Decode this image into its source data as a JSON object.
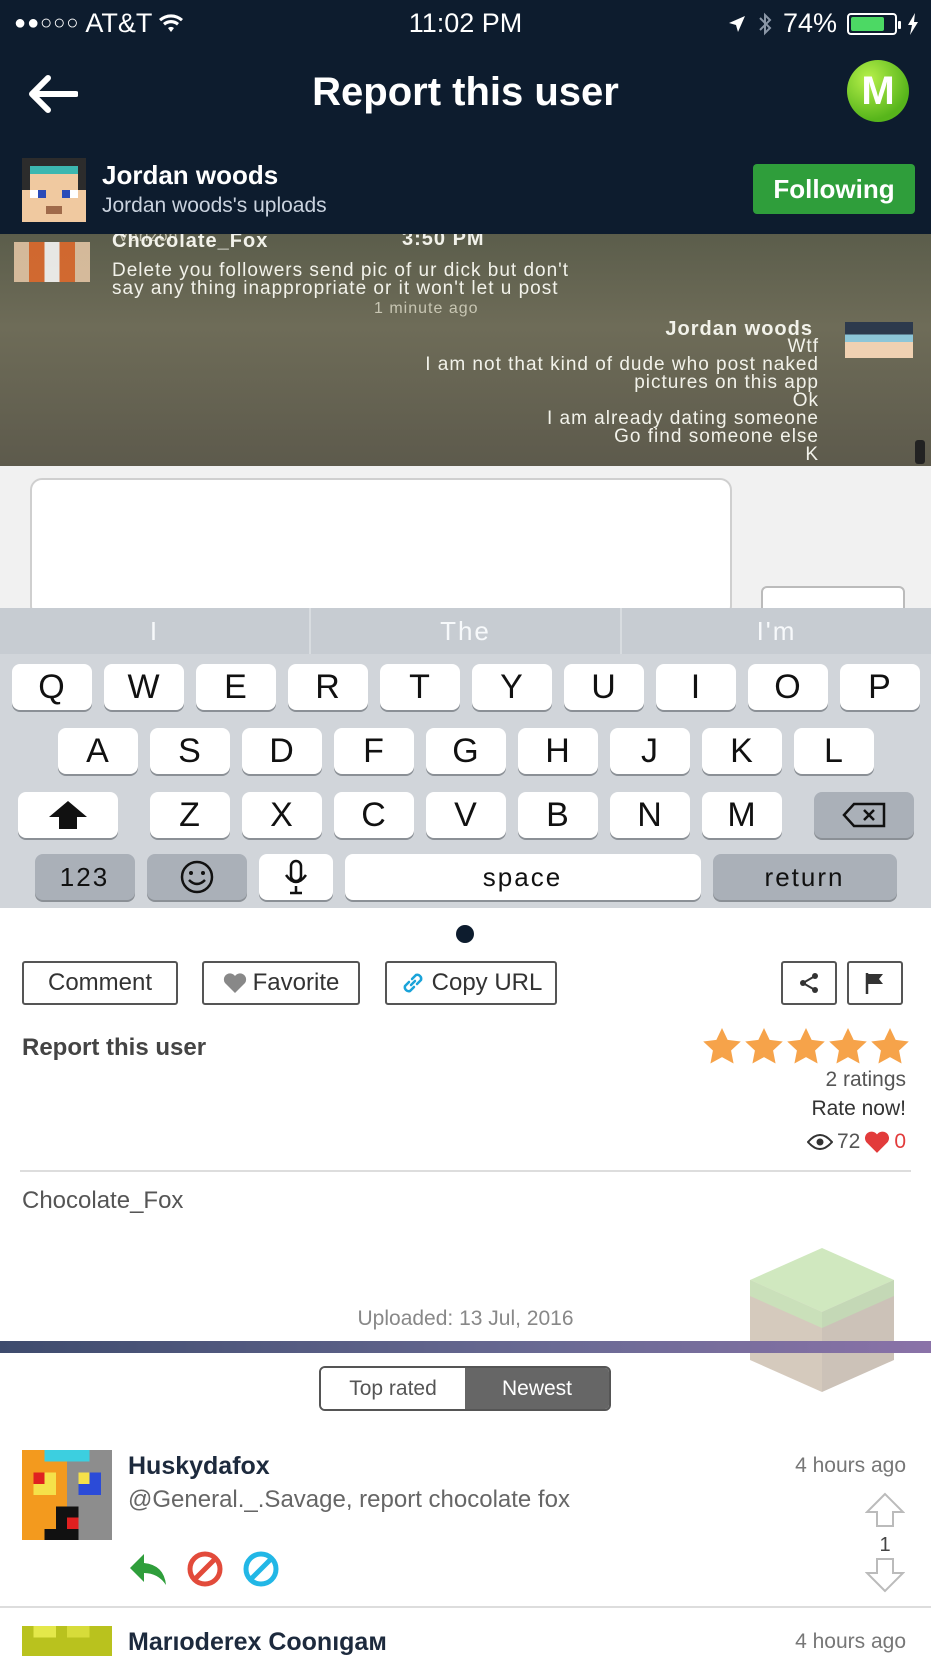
{
  "status_bar": {
    "carrier": "AT&T",
    "time": "11:02 PM",
    "battery": "74%"
  },
  "header": {
    "title": "Report this user",
    "logo_letter": "M"
  },
  "uploader": {
    "name": "Jordan woods",
    "subtitle": "Jordan woods's uploads",
    "follow_label": "Following"
  },
  "screenshot": {
    "top_carrier": "Verizon",
    "top_time": "3:50 PM",
    "sender1": "Chocolate_Fox",
    "msg1a": "Delete you followers send pic of ur dick but don't",
    "msg1b": "say any thing inappropriate or it won't let u post",
    "time1": "1 minute ago",
    "sender2": "Jordan woods",
    "lines2": [
      "Wtf",
      "I am not that kind of dude who post naked",
      "pictures on this app",
      "Ok",
      "I am already dating someone",
      "Go find someone else",
      "K"
    ],
    "suggestions": [
      "I",
      "The",
      "I'm"
    ],
    "keys_row1": [
      "Q",
      "W",
      "E",
      "R",
      "T",
      "Y",
      "U",
      "I",
      "O",
      "P"
    ],
    "keys_row2": [
      "A",
      "S",
      "D",
      "F",
      "G",
      "H",
      "J",
      "K",
      "L"
    ],
    "keys_row3": [
      "Z",
      "X",
      "C",
      "V",
      "B",
      "N",
      "M"
    ],
    "key_123": "123",
    "key_space": "space",
    "key_return": "return"
  },
  "actions": {
    "comment": "Comment",
    "favorite": "Favorite",
    "copy_url": "Copy URL"
  },
  "post": {
    "title": "Report this user",
    "rating_stars": 5,
    "ratings_count": "2 ratings",
    "rate_now": "Rate now!",
    "views": "72",
    "likes": "0",
    "author": "Chocolate_Fox",
    "uploaded": "Uploaded: 13 Jul, 2016"
  },
  "sort_tabs": {
    "top_rated": "Top rated",
    "newest": "Newest",
    "active": "newest"
  },
  "comments": [
    {
      "name": "Huskydafox",
      "time": "4 hours ago",
      "text": "@General._.Savage, report chocolate fox",
      "votes": "1"
    },
    {
      "name": "Marıoderex Coonıgaм",
      "time": "4 hours ago"
    }
  ],
  "colors": {
    "header_bg": "#0d1c2e",
    "follow_green": "#2f9e3b",
    "star_orange": "#f6a34a",
    "heart_red": "#e23b3b"
  }
}
